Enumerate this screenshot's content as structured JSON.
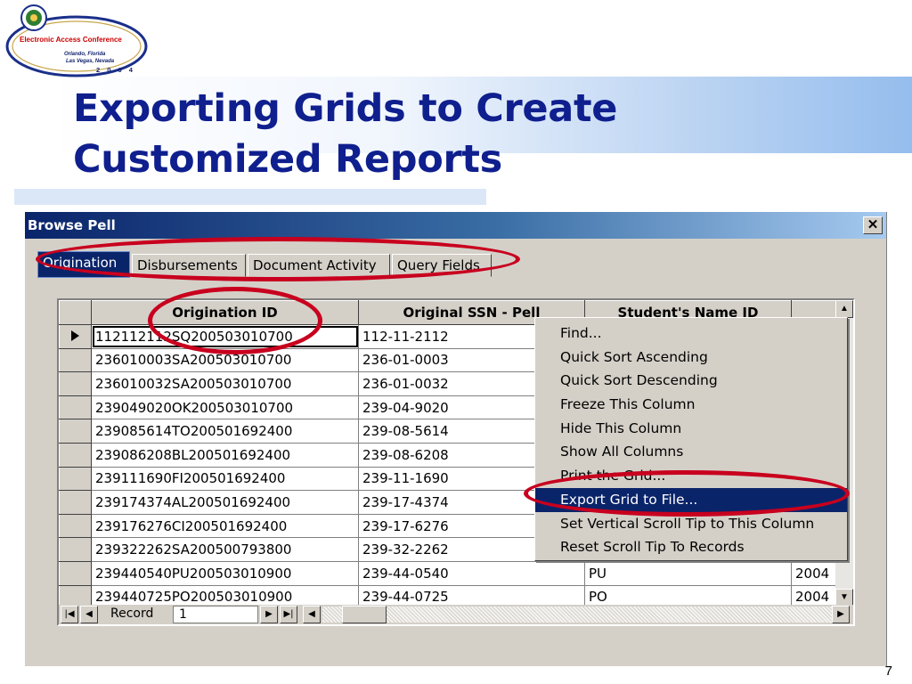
{
  "slide": {
    "title_line1": "Exporting Grids to Create",
    "title_line2": "Customized Reports",
    "page_number": "7"
  },
  "logo": {
    "name": "Electronic Access Conference",
    "city1": "Orlando, Florida",
    "city2": "Las Vegas, Nevada",
    "year": "2 0 0 4"
  },
  "window": {
    "title": "Browse Pell",
    "close_label": "✕"
  },
  "tabs": [
    "Origination",
    "Disbursements",
    "Document Activity",
    "Query Fields"
  ],
  "grid": {
    "columns": [
      "Origination ID",
      "Original SSN - Pell",
      "Student's Name ID",
      ""
    ],
    "rows": [
      [
        "112112112SQ200503010700",
        "112-11-2112",
        "",
        ""
      ],
      [
        "236010003SA200503010700",
        "236-01-0003",
        "",
        ""
      ],
      [
        "236010032SA200503010700",
        "236-01-0032",
        "",
        ""
      ],
      [
        "239049020OK200503010700",
        "239-04-9020",
        "",
        ""
      ],
      [
        "239085614TO200501692400",
        "239-08-5614",
        "",
        ""
      ],
      [
        "239086208BL200501692400",
        "239-08-6208",
        "",
        ""
      ],
      [
        "239111690FI200501692400",
        "239-11-1690",
        "",
        ""
      ],
      [
        "239174374AL200501692400",
        "239-17-4374",
        "",
        ""
      ],
      [
        "239176276CI200501692400",
        "239-17-6276",
        "",
        ""
      ],
      [
        "239322262SA200500793800",
        "239-32-2262",
        "",
        ""
      ],
      [
        "239440540PU200503010900",
        "239-44-0540",
        "PU",
        "2004"
      ],
      [
        "239440725PO200503010900",
        "239-44-0725",
        "PO",
        "2004"
      ]
    ]
  },
  "navigator": {
    "label": "Record",
    "value": "1"
  },
  "context_menu": {
    "items": [
      "Find...",
      "Quick Sort Ascending",
      "Quick Sort Descending",
      "Freeze This Column",
      "Hide This Column",
      "Show All Columns",
      "Print the Grid...",
      "Export Grid to File...",
      "Set Vertical Scroll Tip to This Column",
      "Reset Scroll Tip To Records"
    ],
    "highlighted": "Export Grid to File..."
  },
  "colors": {
    "title": "#0f1f8e",
    "highlight_oval": "#c8001e",
    "menu_highlight": "#0a246a",
    "window_face": "#d4d0c8"
  }
}
